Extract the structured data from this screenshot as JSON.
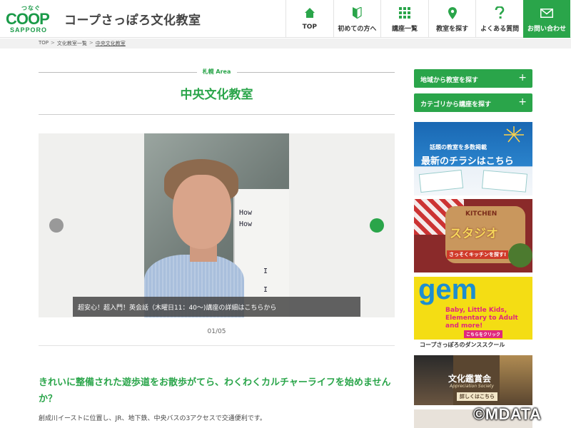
{
  "logo": {
    "tagline": "つなぐ",
    "brand": "COOP",
    "sub": "SAPPORO"
  },
  "site_title": "コープさっぽろ文化教室",
  "nav": [
    {
      "label": "TOP",
      "icon": "home-icon"
    },
    {
      "label": "初めての方へ",
      "icon": "beginner-leaf-icon"
    },
    {
      "label": "講座一覧",
      "icon": "grid-icon"
    },
    {
      "label": "教室を探す",
      "icon": "map-pin-icon"
    },
    {
      "label": "よくある質問",
      "icon": "question-icon"
    },
    {
      "label": "お問い合わせ",
      "icon": "mail-icon"
    }
  ],
  "breadcrumb": [
    "TOP",
    "文化教室一覧",
    "中央文化教室"
  ],
  "breadcrumb_sep": ">",
  "area_label": "札幌 Area",
  "page_title": "中央文化教室",
  "slider": {
    "caption": "超安心！超入門！英会話（木曜日11：40〜)講座の詳細はこちらから",
    "counter": "01/05",
    "board_lines": [
      "How",
      "How",
      "I",
      "I"
    ]
  },
  "headline": "きれいに整備された遊歩道をお散歩がてら、わくわくカルチャーライフを始めませんか？",
  "body": "創成川イーストに位置し、JR、地下鉄、中央バスの3アクセスで交通便利です。",
  "sidebar": {
    "buttons": [
      "地域から教室を探す",
      "カテゴリから講座を探す"
    ],
    "plus": "+",
    "banners": [
      {
        "name": "flyer",
        "title": "話題の教室を多数掲載",
        "main": "最新のチラシはこちら"
      },
      {
        "name": "kitchen",
        "title": "KITCHEN",
        "main": "スタジオ",
        "cta": "さっそくキッチンを探す!"
      },
      {
        "name": "gem",
        "title": "gem",
        "sub": "Baby, Little Kids, Elementary to Adult and more!",
        "cta": "こちらをクリック",
        "footer": "コープさっぽろのダンススクール"
      },
      {
        "name": "appreciation",
        "title": "文化鑑賞会",
        "sub": "Appreciation Society",
        "cta": "詳しくはこちら"
      }
    ]
  },
  "watermark": "©MDATA",
  "colors": {
    "green": "#2aa54a",
    "logo_green": "#1a9a48"
  }
}
